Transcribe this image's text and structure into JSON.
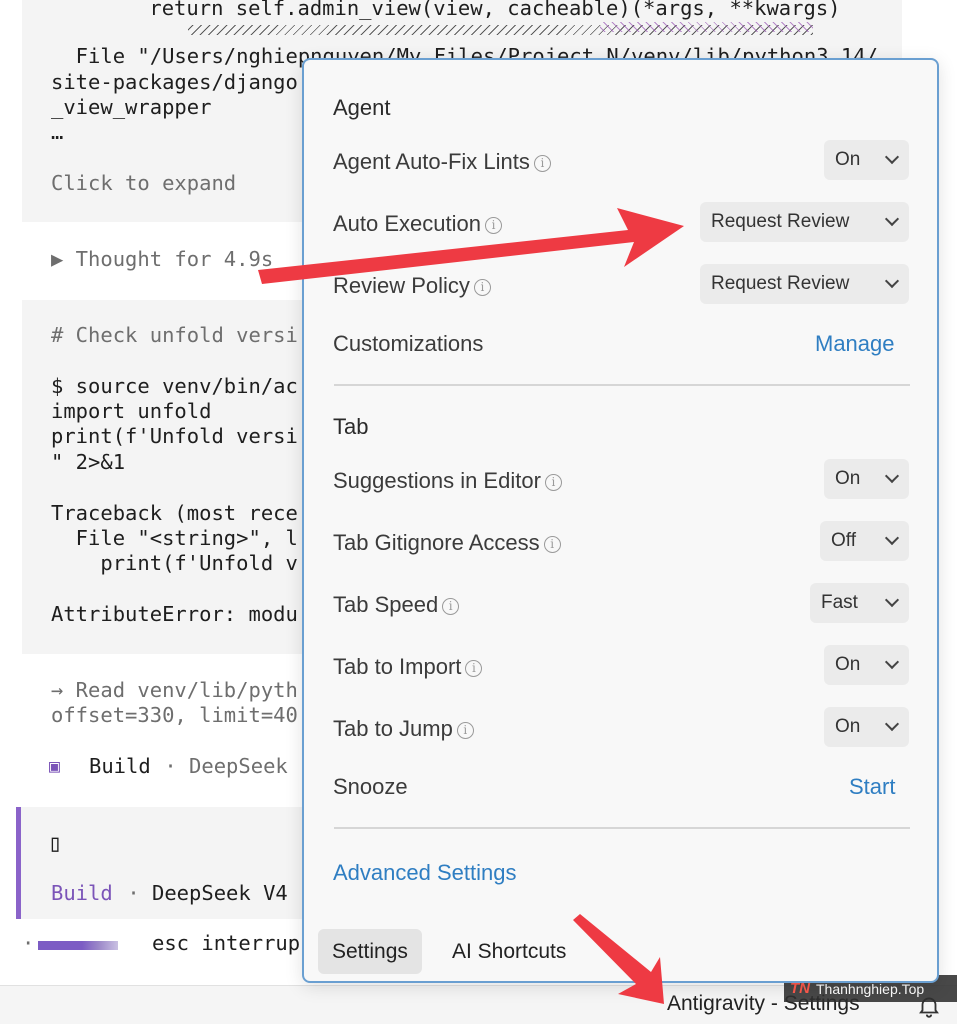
{
  "terminal": {
    "lines": [
      "    return self.admin_view(view, cacheable)(*args, **kwargs)",
      "  File \"/Users/nghiepnguyen/My Files/Project N/venv/lib/python3.14/",
      "site-packages/django",
      "_view_wrapper",
      "…",
      "Click to expand",
      "▶ Thought for 4.9s",
      "# Check unfold versi",
      "$ source venv/bin/ac",
      "import unfold",
      "print(f'Unfold versi",
      "\" 2>&1",
      "Traceback (most rece",
      "  File \"<string>\", l",
      "    print(f'Unfold v",
      "AttributeError: modu",
      "→ Read venv/lib/pyth",
      "offset=330, limit=40",
      "Build",
      " · DeepSeek",
      "▯",
      "Build",
      " · ",
      "DeepSeek V4",
      "esc interrup"
    ],
    "build_icon": "▣",
    "bullet": "·"
  },
  "status_bar": {
    "label": "Antigravity - Settings",
    "bell_icon": "bell-icon"
  },
  "watermark": {
    "logo": "TN",
    "text": "Thanhnghiep.Top"
  },
  "popup": {
    "agent": {
      "title": "Agent",
      "auto_fix_lints": {
        "label": "Agent Auto-Fix Lints",
        "value": "On"
      },
      "auto_execution": {
        "label": "Auto Execution",
        "value": "Request Review"
      },
      "review_policy": {
        "label": "Review Policy",
        "value": "Request Review"
      },
      "customizations": {
        "label": "Customizations",
        "action": "Manage"
      }
    },
    "tab": {
      "title": "Tab",
      "suggestions": {
        "label": "Suggestions in Editor",
        "value": "On"
      },
      "gitignore": {
        "label": "Tab Gitignore Access",
        "value": "Off"
      },
      "speed": {
        "label": "Tab Speed",
        "value": "Fast"
      },
      "import": {
        "label": "Tab to Import",
        "value": "On"
      },
      "jump": {
        "label": "Tab to Jump",
        "value": "On"
      },
      "snooze": {
        "label": "Snooze",
        "action": "Start"
      }
    },
    "advanced": "Advanced Settings",
    "tabs": {
      "settings": "Settings",
      "shortcuts": "AI Shortcuts"
    },
    "info_glyph": "i"
  },
  "colors": {
    "link": "#2f7ec2",
    "popup_border": "#6a9fd1",
    "accent_purple": "#7b54b8",
    "arrow_red": "#ee3a43"
  }
}
